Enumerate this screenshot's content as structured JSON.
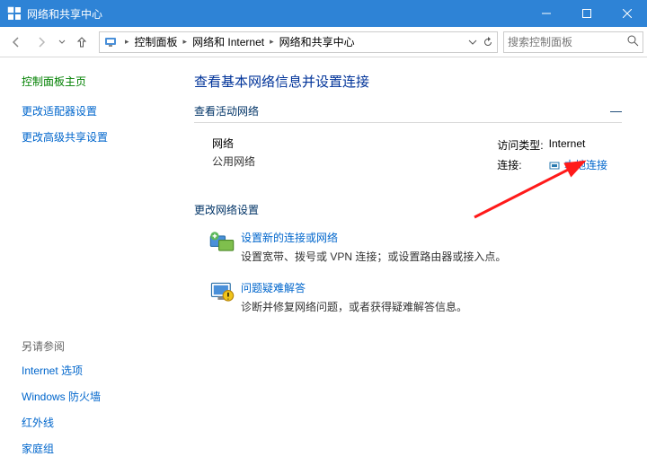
{
  "titlebar": {
    "title": "网络和共享中心"
  },
  "toolbar": {
    "breadcrumbs": [
      "控制面板",
      "网络和 Internet",
      "网络和共享中心"
    ],
    "search_placeholder": "搜索控制面板"
  },
  "sidebar": {
    "title": "控制面板主页",
    "links": [
      "更改适配器设置",
      "更改高级共享设置"
    ],
    "see_also_title": "另请参阅",
    "see_also": [
      "Internet 选项",
      "Windows 防火墙",
      "红外线",
      "家庭组"
    ]
  },
  "main": {
    "title": "查看基本网络信息并设置连接",
    "active_header": "查看活动网络",
    "network": {
      "name": "网络",
      "type": "公用网络",
      "access_label": "访问类型:",
      "access_value": "Internet",
      "conn_label": "连接:",
      "conn_value": "本地连接"
    },
    "change_header": "更改网络设置",
    "actions": [
      {
        "title": "设置新的连接或网络",
        "desc": "设置宽带、拨号或 VPN 连接；或设置路由器或接入点。"
      },
      {
        "title": "问题疑难解答",
        "desc": "诊断并修复网络问题，或者获得疑难解答信息。"
      }
    ]
  }
}
